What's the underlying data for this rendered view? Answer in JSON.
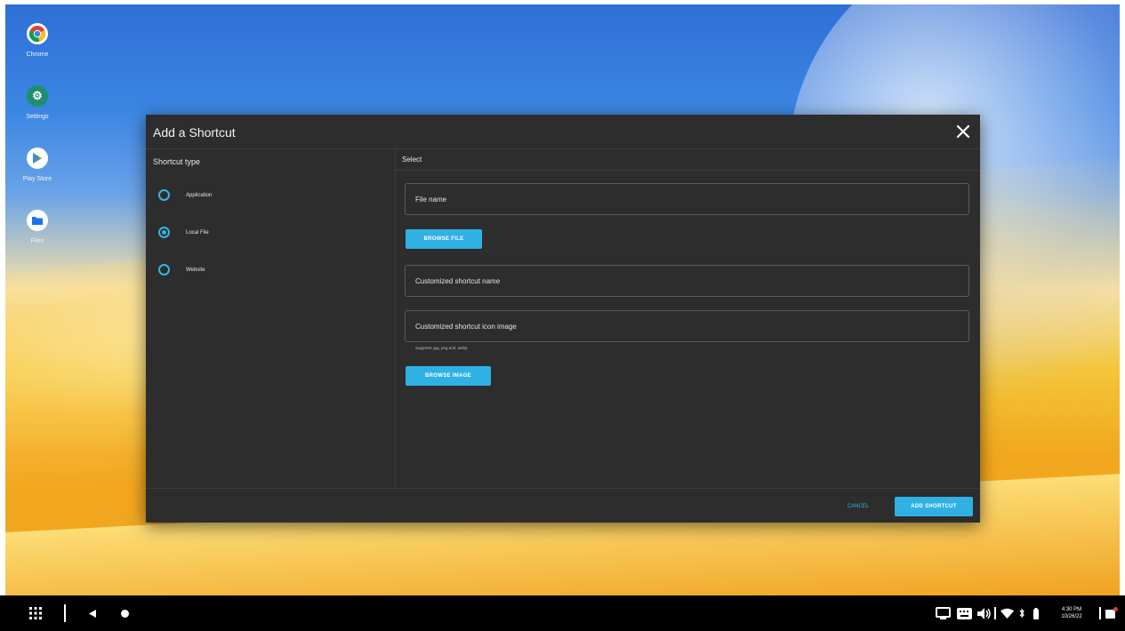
{
  "desktop": {
    "icons": [
      {
        "label": "Chrome",
        "icon": "chrome-icon"
      },
      {
        "label": "Settings",
        "icon": "settings-icon"
      },
      {
        "label": "Play Store",
        "icon": "play-store-icon"
      },
      {
        "label": "Files",
        "icon": "files-icon"
      }
    ]
  },
  "dialog": {
    "title": "Add a Shortcut",
    "close_icon": "close-icon",
    "left": {
      "heading": "Shortcut type",
      "options": [
        {
          "label": "Application",
          "selected": false
        },
        {
          "label": "Local File",
          "selected": true
        },
        {
          "label": "Website",
          "selected": false
        }
      ]
    },
    "right": {
      "heading": "Select",
      "file_name": {
        "placeholder": "File name",
        "value": ""
      },
      "browse_file": "BROWSE FILE",
      "shortcut_name": {
        "placeholder": "Customized shortcut name",
        "value": ""
      },
      "icon_image": {
        "placeholder": "Customized shortcut icon image",
        "value": ""
      },
      "icon_hint": "Supports: jpg, png and .webp",
      "browse_image": "BROWSE IMAGE"
    },
    "footer": {
      "cancel": "CANCEL",
      "add": "ADD SHORTCUT"
    }
  },
  "taskbar": {
    "left_icons": [
      "apps-grid-icon",
      "back-icon",
      "home-icon"
    ],
    "right_icons": [
      "cast-icon",
      "keyboard-icon",
      "volume-icon",
      "wifi-icon",
      "bluetooth-icon",
      "battery-icon",
      "notification-icon"
    ],
    "time": "4:30 PM",
    "date": "10/26/22"
  },
  "colors": {
    "accent": "#2fb1e4",
    "dialog_bg": "#2c2d2c",
    "taskbar_bg": "#000000"
  }
}
